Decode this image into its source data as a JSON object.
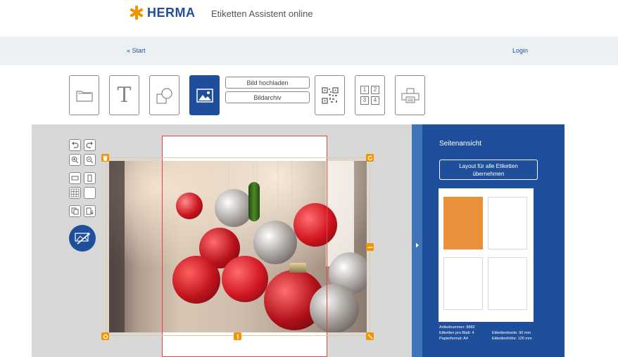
{
  "header": {
    "brand": "HERMA",
    "subtitle": "Etiketten Assistent online"
  },
  "nav": {
    "start": "« Start",
    "login": "Login"
  },
  "toolbar": {
    "upload_label": "Bild hochladen",
    "archive_label": "Bildarchiv",
    "numbers": [
      "1",
      "2",
      "3",
      "4"
    ]
  },
  "panel": {
    "title": "Seitenansicht",
    "apply_button": "Layout für alle Etiketten übernehmen",
    "info": {
      "article": "Artikelnummer: 8882",
      "per_sheet": "Etiketten pro Blatt: 4",
      "paper": "Papierformat: A4",
      "width": "Etikettenbreite: 90 mm",
      "height": "Etikettenhöhe: 120 mm"
    }
  },
  "colors": {
    "brand_orange": "#f29400",
    "panel_blue": "#1f4f9b",
    "canvas_gray": "#d8d8d6",
    "active_label": "#e8903a"
  }
}
